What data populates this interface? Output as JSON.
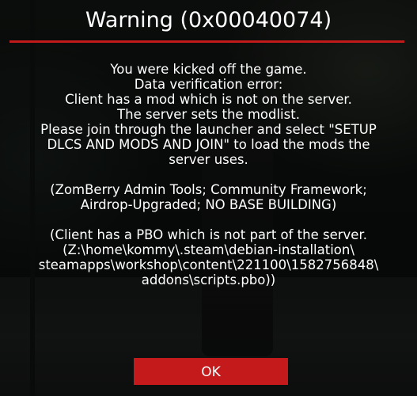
{
  "dialog": {
    "title": "Warning (0x00040074)",
    "message_lines": [
      "You were kicked off the game.",
      "Data verification error:",
      "Client has a mod which is not on the server.",
      "The server sets the modlist.",
      "Please join through the launcher and select \"SETUP",
      "DLCS AND MODS AND JOIN\" to load the mods the",
      "server uses.",
      "",
      "(ZomBerry Admin Tools; Community Framework;",
      "Airdrop-Upgraded; NO BASE BUILDING)",
      "",
      "(Client has a PBO which is not part of the server.",
      "(Z:\\home\\kommy\\.steam\\debian-installation\\",
      "steamapps\\workshop\\content\\221100\\1582756848\\",
      "addons\\scripts.pbo))"
    ],
    "ok_label": "OK"
  },
  "colors": {
    "accent_red": "#c41a1c",
    "text": "#ffffff"
  }
}
